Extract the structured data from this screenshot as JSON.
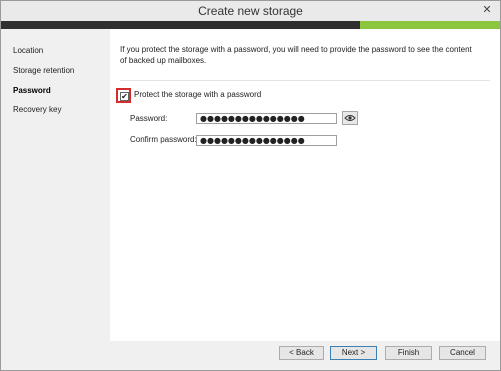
{
  "window": {
    "title": "Create new storage",
    "close_glyph": "✕"
  },
  "colors": {
    "accent_dark": "#2f2f2f",
    "accent_green": "#8cc63f",
    "highlight": "#d62b2b"
  },
  "sidebar": {
    "items": [
      {
        "label": "Location"
      },
      {
        "label": "Storage retention"
      },
      {
        "label": "Password",
        "active": true
      },
      {
        "label": "Recovery key"
      }
    ]
  },
  "content": {
    "info_text": "If you protect the storage with a password, you will need to provide the password to see the content of backed up mailboxes.",
    "protect_checkbox": {
      "label": "Protect the storage with a password",
      "checked": true,
      "check_glyph": "✔"
    },
    "password": {
      "label": "Password:",
      "value": "●●●●●●●●●●●●●●●"
    },
    "confirm": {
      "label": "Confirm password:",
      "value": "●●●●●●●●●●●●●●●"
    },
    "show_password_icon": "eye-icon"
  },
  "footer": {
    "back": "< Back",
    "next": "Next >",
    "finish": "Finish",
    "cancel": "Cancel"
  }
}
